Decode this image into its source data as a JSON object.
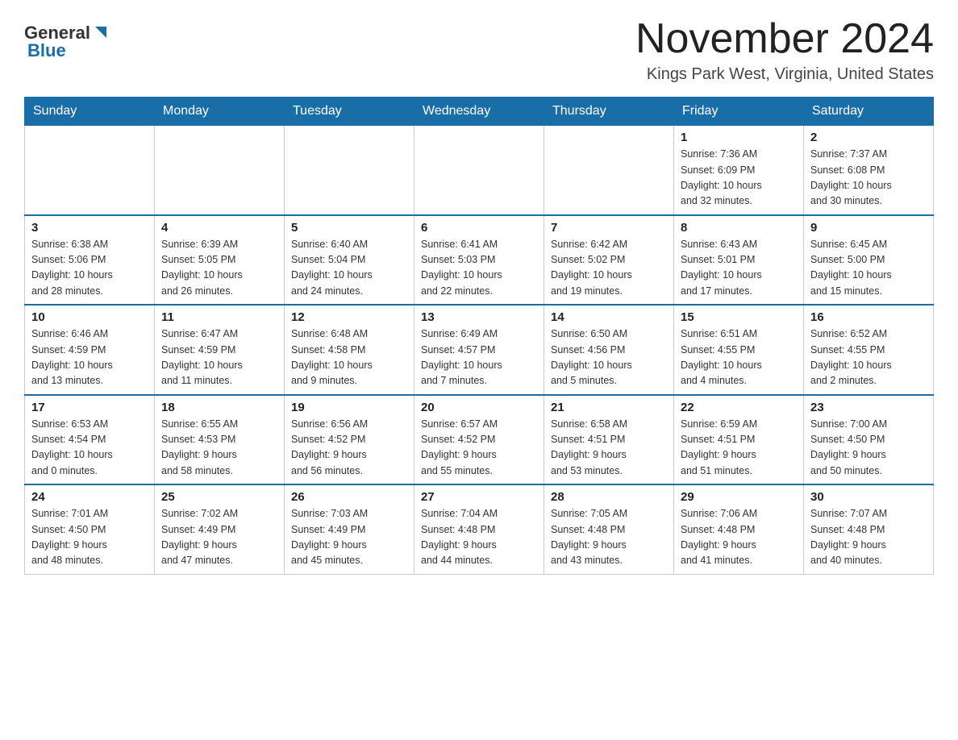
{
  "logo": {
    "part1": "General",
    "part2": "Blue"
  },
  "title": "November 2024",
  "location": "Kings Park West, Virginia, United States",
  "weekdays": [
    "Sunday",
    "Monday",
    "Tuesday",
    "Wednesday",
    "Thursday",
    "Friday",
    "Saturday"
  ],
  "weeks": [
    [
      {
        "day": "",
        "info": ""
      },
      {
        "day": "",
        "info": ""
      },
      {
        "day": "",
        "info": ""
      },
      {
        "day": "",
        "info": ""
      },
      {
        "day": "",
        "info": ""
      },
      {
        "day": "1",
        "info": "Sunrise: 7:36 AM\nSunset: 6:09 PM\nDaylight: 10 hours\nand 32 minutes."
      },
      {
        "day": "2",
        "info": "Sunrise: 7:37 AM\nSunset: 6:08 PM\nDaylight: 10 hours\nand 30 minutes."
      }
    ],
    [
      {
        "day": "3",
        "info": "Sunrise: 6:38 AM\nSunset: 5:06 PM\nDaylight: 10 hours\nand 28 minutes."
      },
      {
        "day": "4",
        "info": "Sunrise: 6:39 AM\nSunset: 5:05 PM\nDaylight: 10 hours\nand 26 minutes."
      },
      {
        "day": "5",
        "info": "Sunrise: 6:40 AM\nSunset: 5:04 PM\nDaylight: 10 hours\nand 24 minutes."
      },
      {
        "day": "6",
        "info": "Sunrise: 6:41 AM\nSunset: 5:03 PM\nDaylight: 10 hours\nand 22 minutes."
      },
      {
        "day": "7",
        "info": "Sunrise: 6:42 AM\nSunset: 5:02 PM\nDaylight: 10 hours\nand 19 minutes."
      },
      {
        "day": "8",
        "info": "Sunrise: 6:43 AM\nSunset: 5:01 PM\nDaylight: 10 hours\nand 17 minutes."
      },
      {
        "day": "9",
        "info": "Sunrise: 6:45 AM\nSunset: 5:00 PM\nDaylight: 10 hours\nand 15 minutes."
      }
    ],
    [
      {
        "day": "10",
        "info": "Sunrise: 6:46 AM\nSunset: 4:59 PM\nDaylight: 10 hours\nand 13 minutes."
      },
      {
        "day": "11",
        "info": "Sunrise: 6:47 AM\nSunset: 4:59 PM\nDaylight: 10 hours\nand 11 minutes."
      },
      {
        "day": "12",
        "info": "Sunrise: 6:48 AM\nSunset: 4:58 PM\nDaylight: 10 hours\nand 9 minutes."
      },
      {
        "day": "13",
        "info": "Sunrise: 6:49 AM\nSunset: 4:57 PM\nDaylight: 10 hours\nand 7 minutes."
      },
      {
        "day": "14",
        "info": "Sunrise: 6:50 AM\nSunset: 4:56 PM\nDaylight: 10 hours\nand 5 minutes."
      },
      {
        "day": "15",
        "info": "Sunrise: 6:51 AM\nSunset: 4:55 PM\nDaylight: 10 hours\nand 4 minutes."
      },
      {
        "day": "16",
        "info": "Sunrise: 6:52 AM\nSunset: 4:55 PM\nDaylight: 10 hours\nand 2 minutes."
      }
    ],
    [
      {
        "day": "17",
        "info": "Sunrise: 6:53 AM\nSunset: 4:54 PM\nDaylight: 10 hours\nand 0 minutes."
      },
      {
        "day": "18",
        "info": "Sunrise: 6:55 AM\nSunset: 4:53 PM\nDaylight: 9 hours\nand 58 minutes."
      },
      {
        "day": "19",
        "info": "Sunrise: 6:56 AM\nSunset: 4:52 PM\nDaylight: 9 hours\nand 56 minutes."
      },
      {
        "day": "20",
        "info": "Sunrise: 6:57 AM\nSunset: 4:52 PM\nDaylight: 9 hours\nand 55 minutes."
      },
      {
        "day": "21",
        "info": "Sunrise: 6:58 AM\nSunset: 4:51 PM\nDaylight: 9 hours\nand 53 minutes."
      },
      {
        "day": "22",
        "info": "Sunrise: 6:59 AM\nSunset: 4:51 PM\nDaylight: 9 hours\nand 51 minutes."
      },
      {
        "day": "23",
        "info": "Sunrise: 7:00 AM\nSunset: 4:50 PM\nDaylight: 9 hours\nand 50 minutes."
      }
    ],
    [
      {
        "day": "24",
        "info": "Sunrise: 7:01 AM\nSunset: 4:50 PM\nDaylight: 9 hours\nand 48 minutes."
      },
      {
        "day": "25",
        "info": "Sunrise: 7:02 AM\nSunset: 4:49 PM\nDaylight: 9 hours\nand 47 minutes."
      },
      {
        "day": "26",
        "info": "Sunrise: 7:03 AM\nSunset: 4:49 PM\nDaylight: 9 hours\nand 45 minutes."
      },
      {
        "day": "27",
        "info": "Sunrise: 7:04 AM\nSunset: 4:48 PM\nDaylight: 9 hours\nand 44 minutes."
      },
      {
        "day": "28",
        "info": "Sunrise: 7:05 AM\nSunset: 4:48 PM\nDaylight: 9 hours\nand 43 minutes."
      },
      {
        "day": "29",
        "info": "Sunrise: 7:06 AM\nSunset: 4:48 PM\nDaylight: 9 hours\nand 41 minutes."
      },
      {
        "day": "30",
        "info": "Sunrise: 7:07 AM\nSunset: 4:48 PM\nDaylight: 9 hours\nand 40 minutes."
      }
    ]
  ]
}
